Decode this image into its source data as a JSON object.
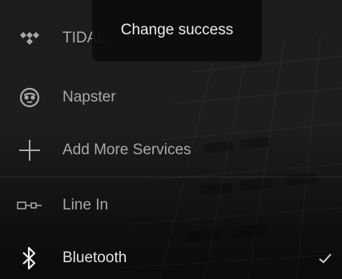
{
  "toast": {
    "message": "Change success"
  },
  "services": [
    {
      "label": "TIDAL",
      "icon": "tidal-icon"
    },
    {
      "label": "Napster",
      "icon": "napster-icon"
    },
    {
      "label": "Add More Services",
      "icon": "plus-icon"
    }
  ],
  "inputs": [
    {
      "label": "Line In",
      "icon": "line-in-icon"
    },
    {
      "label": "Bluetooth",
      "icon": "bluetooth-icon",
      "selected": true
    }
  ],
  "selected_indicator": "checkmark-icon",
  "colors": {
    "label": "#a9a9a9",
    "active_label": "#e4e4e4",
    "toast_bg": "#0c0c0c"
  }
}
